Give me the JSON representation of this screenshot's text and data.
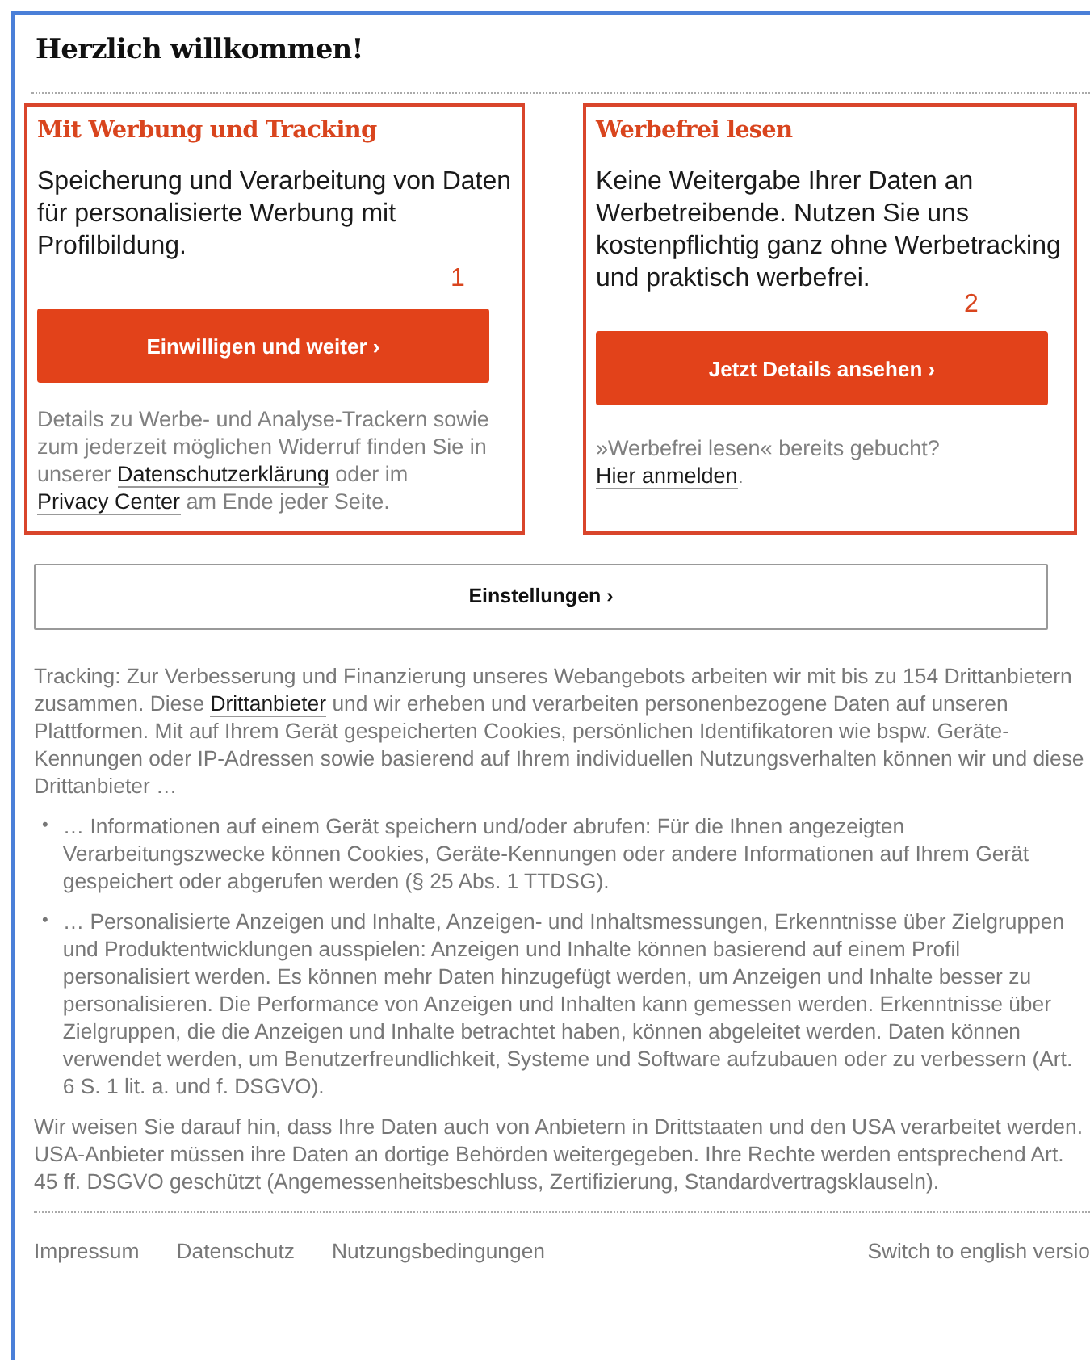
{
  "title": "Herzlich willkommen!",
  "options": [
    {
      "heading": "Mit Werbung und Tracking",
      "text": "Speicherung und Verarbeitung von Daten für personalisierte Werbung mit Profilbildung.",
      "marker": "1",
      "button": "Einwilligen und weiter ›",
      "note": [
        {
          "kind": "text",
          "text": "Details zu Werbe- und Analyse-Trackern sowie zum jederzeit möglichen Widerruf finden Sie in unserer "
        },
        {
          "kind": "link",
          "text": "Datenschutzerklärung"
        },
        {
          "kind": "text",
          "text": " oder im "
        },
        {
          "kind": "link",
          "text": "Privacy Center"
        },
        {
          "kind": "text",
          "text": " am Ende jeder Seite."
        }
      ]
    },
    {
      "heading": "Werbefrei lesen",
      "text": "Keine Weitergabe Ihrer Daten an Werbetreibende. Nutzen Sie uns kostenpflichtig ganz ohne Werbetracking und praktisch werbefrei.",
      "marker": "2",
      "button": "Jetzt Details ansehen ›",
      "note": [
        {
          "kind": "text",
          "text": "»Werbefrei lesen« bereits gebucht? "
        },
        {
          "kind": "link",
          "text": "Hier anmelden"
        },
        {
          "kind": "text",
          "text": "."
        }
      ]
    }
  ],
  "settings_button": "Einstellungen ›",
  "intro": [
    {
      "kind": "text",
      "text": "Tracking: Zur Verbesserung und Finanzierung unseres Webangebots arbeiten wir mit bis zu 154 Drittanbietern zusammen. Diese "
    },
    {
      "kind": "link",
      "text": "Drittanbieter"
    },
    {
      "kind": "text",
      "text": " und wir erheben und verarbeiten personenbezogene Daten auf unseren Plattformen. Mit auf Ihrem Gerät gespeicherten Cookies, persönlichen Identifikatoren wie bspw. Geräte-Kennungen oder IP-Adressen sowie basierend auf Ihrem individuellen Nutzungsverhalten können wir und diese Drittanbieter …"
    }
  ],
  "purposes": [
    {
      "bullet": "•",
      "text": "… Informationen auf einem Gerät speichern und/oder abrufen: Für die Ihnen angezeigten Verarbeitungszwecke können Cookies, Geräte-Kennungen oder andere Informationen auf Ihrem Gerät gespeichert oder abgerufen werden (§ 25 Abs. 1 TTDSG)."
    },
    {
      "bullet": "•",
      "text": "… Personalisierte Anzeigen und Inhalte, Anzeigen- und Inhaltsmessungen, Erkenntnisse über Zielgruppen und Produktentwicklungen ausspielen: Anzeigen und Inhalte können basierend auf einem Profil personalisiert werden. Es können mehr Daten hinzugefügt werden, um Anzeigen und Inhalte besser zu personalisieren. Die Performance von Anzeigen und Inhalten kann gemessen werden. Erkenntnisse über Zielgruppen, die die Anzeigen und Inhalte betrachtet haben, können abgeleitet werden. Daten können verwendet werden, um Benutzerfreundlichkeit, Systeme und Software aufzubauen oder zu verbessern (Art. 6 S. 1 lit. a. und f. DSGVO)."
    }
  ],
  "notice": "Wir weisen Sie darauf hin, dass Ihre Daten auch von Anbietern in Drittstaaten und den USA verarbeitet werden. USA-Anbieter müssen ihre Daten an dortige Behörden weitergegeben. Ihre Rechte werden entsprechend Art. 45 ff. DSGVO geschützt (Angemessenheitsbeschluss, Zertifizierung, Standardvertragsklauseln).",
  "footer_links": [
    "Impressum",
    "Datenschutz",
    "Nutzungsbedingungen"
  ],
  "language_switch": "Switch to english versio"
}
